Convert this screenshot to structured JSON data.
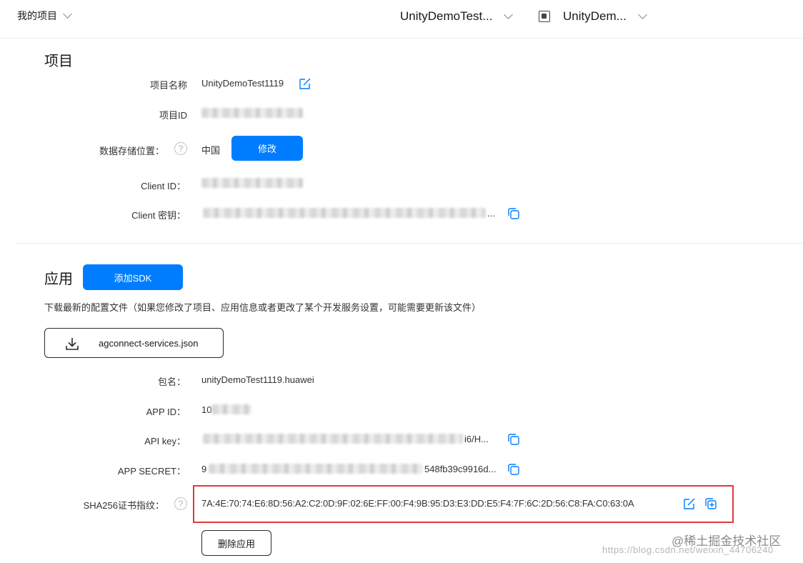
{
  "topbar": {
    "project_menu": "我的项目",
    "project_select": "UnityDemoTest...",
    "app_select": "UnityDem..."
  },
  "project": {
    "section_title": "项目",
    "name_label": "项目名称",
    "name_value": "UnityDemoTest1119",
    "id_label": "项目ID",
    "storage_label": "数据存储位置：",
    "storage_value": "中国",
    "modify_button": "修改",
    "client_id_label": "Client ID：",
    "client_secret_label": "Client 密钥：",
    "client_secret_tail": "..."
  },
  "app": {
    "section_title": "应用",
    "add_sdk_button": "添加SDK",
    "download_hint": "下载最新的配置文件（如果您修改了项目、应用信息或者更改了某个开发服务设置，可能需要更新该文件）",
    "download_file": "agconnect-services.json",
    "package_label": "包名：",
    "package_value": "unityDemoTest1119.huawei",
    "app_id_label": "APP ID：",
    "app_id_value": "10",
    "api_key_label": "API key：",
    "api_key_tail": "i6/H...",
    "app_secret_label": "APP SECRET：",
    "app_secret_head": "9",
    "app_secret_tail": "548fb39c9916d...",
    "sha_label": "SHA256证书指纹：",
    "sha_value": "7A:4E:70:74:E6:8D:56:A2:C2:0D:9F:02:6E:FF:00:F4:9B:95:D3:E3:DD:E5:F4:7F:6C:2D:56:C8:FA:C0:63:0A",
    "delete_button": "删除应用"
  },
  "help_glyph": "?",
  "watermark": {
    "line1": "@稀土掘金技术社区",
    "line2": "https://blog.csdn.net/weixin_44706240"
  },
  "colors": {
    "primary": "#007dff",
    "highlight_border": "#e03a3a"
  },
  "icons": [
    "chevron-down-icon",
    "android-icon",
    "edit-icon",
    "help-icon",
    "copy-icon",
    "download-icon",
    "add-copy-icon"
  ]
}
